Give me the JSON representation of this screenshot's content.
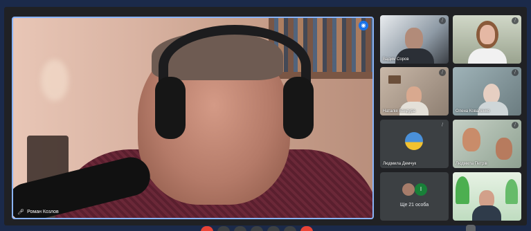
{
  "main_speaker": {
    "name": "Роман Козлов",
    "speaking_icon": "sound-wave-icon",
    "mic_icon": "mic-icon"
  },
  "participants": [
    {
      "name": "Вадим Соров",
      "corner_icon": "mic-off-icon"
    },
    {
      "name": "",
      "corner_icon": "mic-off-icon"
    },
    {
      "name": "Наталія Бандура",
      "corner_icon": "mic-off-icon"
    },
    {
      "name": "Олена Коваленко",
      "corner_icon": "mic-off-icon"
    },
    {
      "name": "Людмила Демчук",
      "corner_icon": "mic-off-icon"
    },
    {
      "name": "Людмила Петрів",
      "corner_icon": "mic-off-icon"
    },
    {
      "name": "",
      "corner_icon": ""
    }
  ],
  "more_tile": {
    "label": "Ще 21 особа",
    "avatar_letter": "І"
  },
  "colors": {
    "background": "#1b2a4a",
    "active_border": "#8ab4f8",
    "end_call": "#ea4335"
  }
}
